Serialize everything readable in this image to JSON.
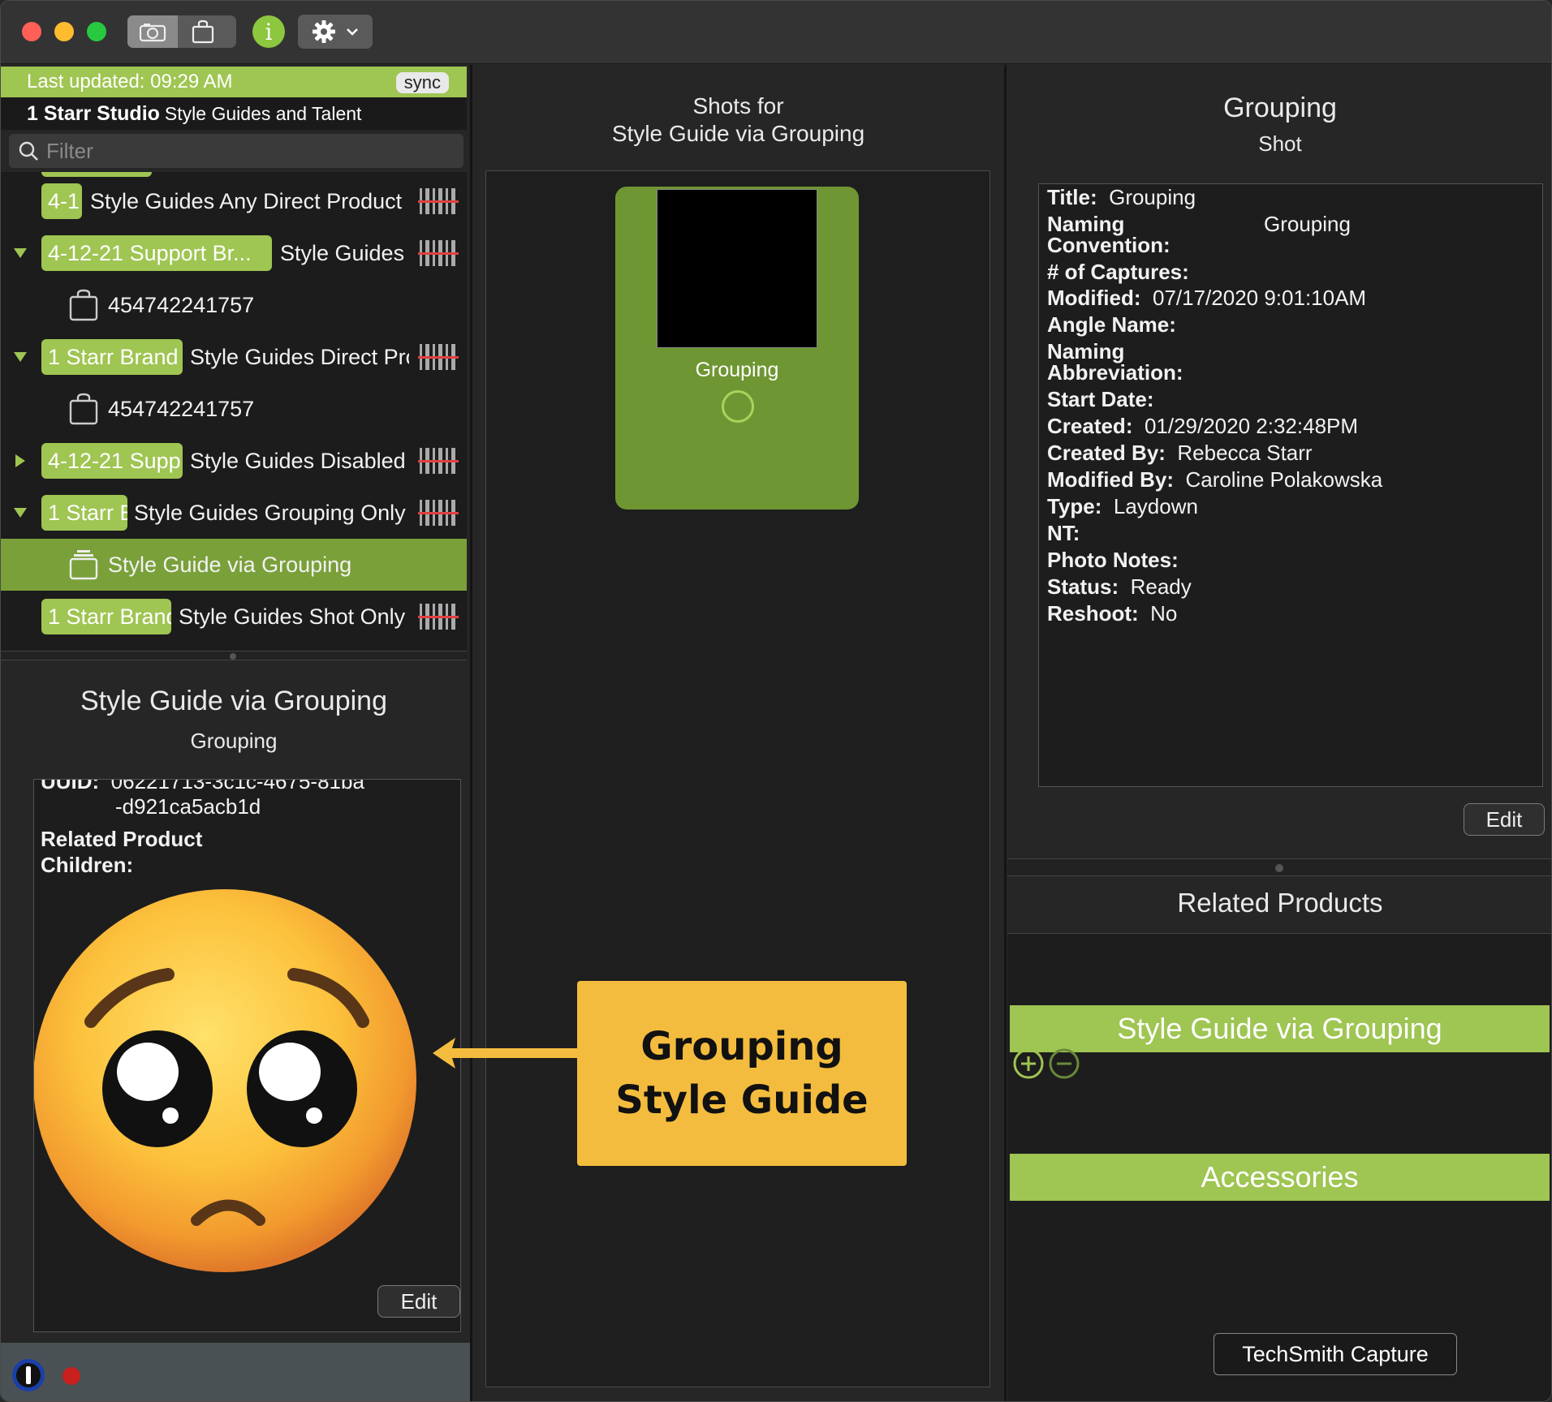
{
  "toolbar": {
    "info_glyph": "i",
    "icons": [
      "camera-icon",
      "bag-icon",
      "info-icon",
      "gear-icon",
      "chevron-down-icon"
    ]
  },
  "sidebar": {
    "last_updated": "Last updated: 09:29 AM",
    "sync_label": "sync",
    "studio_bold": "1 Starr Studio",
    "studio_rest": "Style Guides and Talent",
    "filter_placeholder": "Filter",
    "rows": [
      {
        "pill": "4-1",
        "text": "Style Guides Any Direct Product"
      },
      {
        "pill": "4-12-21 Support Br...",
        "text": "Style Guides"
      },
      {
        "bag": "454742241757"
      },
      {
        "pill": "1 Starr Brand",
        "text": "Style Guides Direct Pro"
      },
      {
        "bag": "454742241757"
      },
      {
        "pill": "4-12-21 Supp",
        "text": "Style Guides Disabled"
      },
      {
        "pill": "1 Starr E",
        "text": "Style Guides Grouping Only"
      },
      {
        "selected": "Style Guide via Grouping"
      },
      {
        "pill": "1 Starr Brand",
        "text": "Style Guides Shot Only"
      }
    ]
  },
  "left_detail": {
    "title": "Style Guide via Grouping",
    "subtitle": "Grouping",
    "uuid_label": "UUID:",
    "uuid_value_1": "06221713-3c1c-4675-81ba",
    "uuid_value_2": "-d921ca5acb1d",
    "related_label_1": "Related Product",
    "related_label_2": "Children:",
    "edit_label": "Edit"
  },
  "middle": {
    "title_line1": "Shots for",
    "title_line2": "Style Guide via Grouping",
    "shot_label": "Grouping"
  },
  "callout": {
    "line1": "Grouping",
    "line2": "Style Guide",
    "color": "#f4bc3e"
  },
  "right_detail": {
    "title": "Grouping",
    "subtitle": "Shot",
    "fields": {
      "title_label": "Title:",
      "title_value": "Grouping",
      "naming_label_1": "Naming",
      "naming_label_2": "Convention:",
      "naming_value": "Grouping",
      "captures_label": "# of Captures:",
      "modified_label": "Modified:",
      "modified_value": "07/17/2020 9:01:10AM",
      "angle_label": "Angle Name:",
      "abbr_label_1": "Naming",
      "abbr_label_2": "Abbreviation:",
      "start_label": "Start Date:",
      "created_label": "Created:",
      "created_value": "01/29/2020 2:32:48PM",
      "createdby_label": "Created By:",
      "createdby_value": "Rebecca Starr",
      "modifiedby_label": "Modified By:",
      "modifiedby_value": "Caroline Polakowska",
      "type_label": "Type:",
      "type_value": "Laydown",
      "nt_label": "NT:",
      "photonotes_label": "Photo Notes:",
      "status_label": "Status:",
      "status_value": "Ready",
      "reshoot_label": "Reshoot:",
      "reshoot_value": "No"
    },
    "edit_label": "Edit"
  },
  "related_products": {
    "title": "Related Products",
    "items": [
      "Style Guide via Grouping",
      "Accessories"
    ]
  },
  "tooltip": "TechSmith Capture",
  "colors": {
    "accent_green": "#9fc552",
    "card_green": "#6e9632",
    "close": "#ff5f57",
    "minimize": "#febc2e",
    "zoom": "#28c840"
  }
}
